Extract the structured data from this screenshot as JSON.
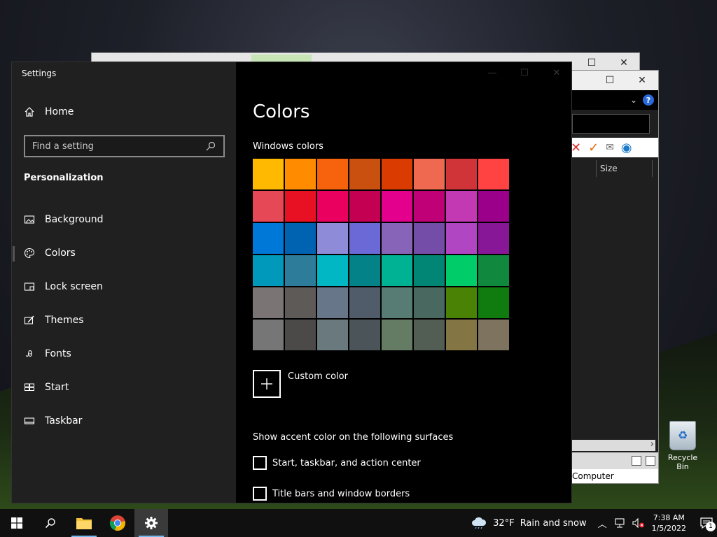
{
  "settings": {
    "app_title": "Settings",
    "home_label": "Home",
    "search_placeholder": "Find a setting",
    "section_title": "Personalization",
    "nav": [
      {
        "label": "Background",
        "icon": "image-icon"
      },
      {
        "label": "Colors",
        "icon": "palette-icon"
      },
      {
        "label": "Lock screen",
        "icon": "lock-screen-icon"
      },
      {
        "label": "Themes",
        "icon": "brush-icon"
      },
      {
        "label": "Fonts",
        "icon": "fonts-icon"
      },
      {
        "label": "Start",
        "icon": "start-icon"
      },
      {
        "label": "Taskbar",
        "icon": "taskbar-icon"
      }
    ],
    "active_nav": "Colors"
  },
  "content": {
    "title": "Colors",
    "windows_colors_heading": "Windows colors",
    "swatches": [
      "#ffb900",
      "#ff8c00",
      "#f7630c",
      "#ca5010",
      "#da3b01",
      "#ef6950",
      "#d13438",
      "#ff4343",
      "#e74856",
      "#e81123",
      "#ea005e",
      "#c30052",
      "#e3008c",
      "#bf0077",
      "#c239b3",
      "#9a0089",
      "#0078d7",
      "#0063b1",
      "#8e8cd8",
      "#6b69d6",
      "#8764b8",
      "#744da9",
      "#b146c2",
      "#881798",
      "#0099bc",
      "#2d7d9a",
      "#00b7c3",
      "#038387",
      "#00b294",
      "#018574",
      "#00cc6a",
      "#10893e",
      "#7a7574",
      "#5d5a58",
      "#68768a",
      "#515c6b",
      "#567c73",
      "#486860",
      "#498205",
      "#107c10",
      "#767676",
      "#4c4a48",
      "#69797e",
      "#4a5459",
      "#647c64",
      "#525e54",
      "#847545",
      "#7e735f"
    ],
    "custom_color_label": "Custom color",
    "surfaces_heading": "Show accent color on the following surfaces",
    "checkboxes": [
      {
        "label": "Start, taskbar, and action center",
        "checked": false
      },
      {
        "label": "Title bars and window borders",
        "checked": false
      }
    ]
  },
  "background_window": {
    "size_column": "Size",
    "status_text": "Computer"
  },
  "desktop": {
    "recycle_bin_label": "Recycle Bin"
  },
  "taskbar": {
    "weather_temp": "32°F",
    "weather_text": "Rain and snow",
    "time": "7:38 AM",
    "date": "1/5/2022",
    "notification_count": "1"
  }
}
